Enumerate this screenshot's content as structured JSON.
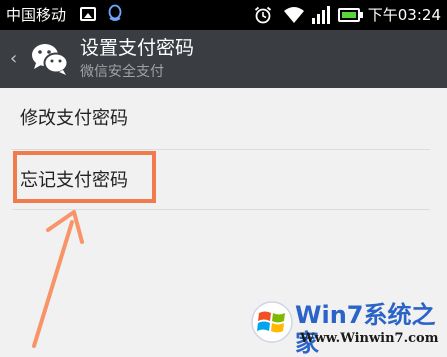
{
  "status_bar": {
    "carrier": "中国移动",
    "time": "下午03:24",
    "icons": [
      "image-icon",
      "qq-icon",
      "alarm-icon",
      "wifi-icon",
      "signal-icon",
      "battery-icon"
    ],
    "battery_color": "#5ad53c"
  },
  "action_bar": {
    "back_glyph": "‹",
    "title": "设置支付密码",
    "subtitle": "微信安全支付",
    "background": "#3a3d42"
  },
  "list": {
    "items": [
      {
        "label": "修改支付密码"
      },
      {
        "label": "忘记支付密码"
      }
    ]
  },
  "annotation": {
    "highlight_color": "#f27b4d"
  },
  "watermark": {
    "title": "Win7系统之家",
    "url": "Www.Winwin7.com"
  }
}
